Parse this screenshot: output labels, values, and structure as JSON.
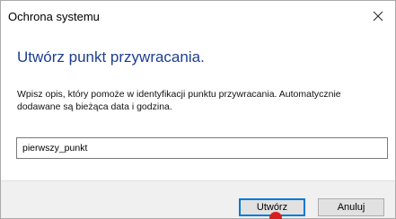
{
  "window": {
    "title": "Ochrona systemu",
    "close_symbol": "✕"
  },
  "dialog": {
    "main_instruction": "Utwórz punkt przywracania.",
    "description": "Wpisz opis, który pomoże w identyfikacji punktu przywracania. Automatycznie dodawane są bieżąca data i godzina.",
    "name_value": "pierwszy_punkt"
  },
  "buttons": {
    "create_label": "Utwórz",
    "cancel_label": "Anuluj"
  },
  "colors": {
    "instruction_text": "#1d3f8f",
    "focus_border": "#0078d7",
    "footer_background": "#f0f0f0",
    "pointer_marker": "#d62020"
  }
}
